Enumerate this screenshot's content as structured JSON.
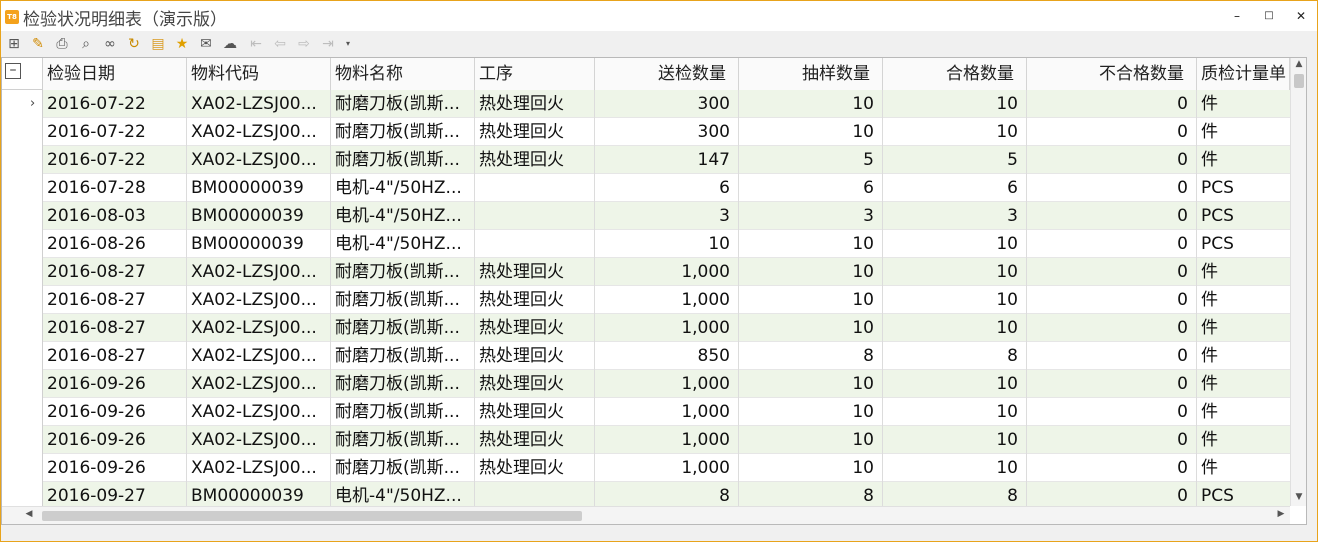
{
  "window": {
    "title": "检验状况明细表（演示版）",
    "app_icon_text": "T8",
    "accent_color": "#e8a31b",
    "minimize": "–",
    "maximize": "□",
    "close": "✕"
  },
  "toolbar": {
    "icons": [
      "tree-icon",
      "print-preview-icon",
      "print-icon",
      "search-icon",
      "binoculars-icon",
      "refresh-icon",
      "export-icon",
      "favorite-star-icon",
      "mail-icon",
      "chat-icon",
      "first-page-icon",
      "previous-page-icon",
      "next-page-icon",
      "last-page-icon",
      "dropdown-arrow-icon"
    ]
  },
  "grid": {
    "corner_glyph": "–",
    "current_row_glyph": "›",
    "columns": [
      "检验日期",
      "物料代码",
      "物料名称",
      "工序",
      "送检数量",
      "抽样数量",
      "合格数量",
      "不合格数量",
      "质检计量单"
    ],
    "rows": [
      [
        "2016-07-22",
        "XA02-LZSJ00...",
        "耐磨刀板(凯斯...",
        "热处理回火",
        "300",
        "10",
        "10",
        "0",
        "件"
      ],
      [
        "2016-07-22",
        "XA02-LZSJ00...",
        "耐磨刀板(凯斯...",
        "热处理回火",
        "300",
        "10",
        "10",
        "0",
        "件"
      ],
      [
        "2016-07-22",
        "XA02-LZSJ00...",
        "耐磨刀板(凯斯...",
        "热处理回火",
        "147",
        "5",
        "5",
        "0",
        "件"
      ],
      [
        "2016-07-28",
        "BM00000039",
        "电机-4\"/50HZ...",
        "",
        "6",
        "6",
        "6",
        "0",
        "PCS"
      ],
      [
        "2016-08-03",
        "BM00000039",
        "电机-4\"/50HZ...",
        "",
        "3",
        "3",
        "3",
        "0",
        "PCS"
      ],
      [
        "2016-08-26",
        "BM00000039",
        "电机-4\"/50HZ...",
        "",
        "10",
        "10",
        "10",
        "0",
        "PCS"
      ],
      [
        "2016-08-27",
        "XA02-LZSJ00...",
        "耐磨刀板(凯斯...",
        "热处理回火",
        "1,000",
        "10",
        "10",
        "0",
        "件"
      ],
      [
        "2016-08-27",
        "XA02-LZSJ00...",
        "耐磨刀板(凯斯...",
        "热处理回火",
        "1,000",
        "10",
        "10",
        "0",
        "件"
      ],
      [
        "2016-08-27",
        "XA02-LZSJ00...",
        "耐磨刀板(凯斯...",
        "热处理回火",
        "1,000",
        "10",
        "10",
        "0",
        "件"
      ],
      [
        "2016-08-27",
        "XA02-LZSJ00...",
        "耐磨刀板(凯斯...",
        "热处理回火",
        "850",
        "8",
        "8",
        "0",
        "件"
      ],
      [
        "2016-09-26",
        "XA02-LZSJ00...",
        "耐磨刀板(凯斯...",
        "热处理回火",
        "1,000",
        "10",
        "10",
        "0",
        "件"
      ],
      [
        "2016-09-26",
        "XA02-LZSJ00...",
        "耐磨刀板(凯斯...",
        "热处理回火",
        "1,000",
        "10",
        "10",
        "0",
        "件"
      ],
      [
        "2016-09-26",
        "XA02-LZSJ00...",
        "耐磨刀板(凯斯...",
        "热处理回火",
        "1,000",
        "10",
        "10",
        "0",
        "件"
      ],
      [
        "2016-09-26",
        "XA02-LZSJ00...",
        "耐磨刀板(凯斯...",
        "热处理回火",
        "1,000",
        "10",
        "10",
        "0",
        "件"
      ],
      [
        "2016-09-27",
        "BM00000039",
        "电机-4\"/50HZ...",
        "",
        "8",
        "8",
        "8",
        "0",
        "PCS"
      ]
    ],
    "row_alt_color": "#eef5e8"
  }
}
